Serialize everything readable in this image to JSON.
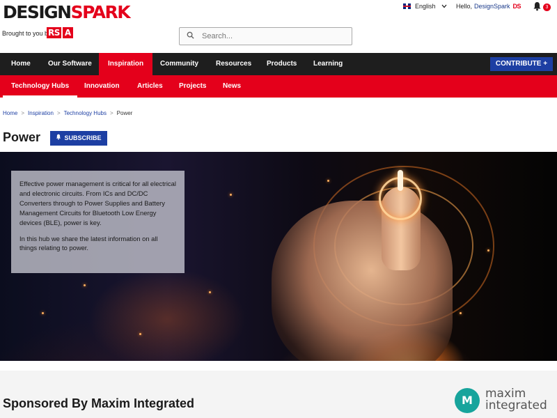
{
  "header": {
    "logo_part1": "DESIGN",
    "logo_part2": "SPARK",
    "brought_by": "Brought to you by",
    "partner_logo_1": "RS",
    "partner_logo_2": "A",
    "search_placeholder": "Search...",
    "language": "English",
    "greeting": "Hello,",
    "username": "DesignSpark",
    "user_badge": "DS",
    "notification_count": "3"
  },
  "main_nav": {
    "items": [
      "Home",
      "Our Software",
      "Inspiration",
      "Community",
      "Resources",
      "Products",
      "Learning"
    ],
    "active": "Inspiration",
    "contribute_label": "CONTRIBUTE +"
  },
  "sub_nav": {
    "items": [
      "Technology Hubs",
      "Innovation",
      "Articles",
      "Projects",
      "News"
    ],
    "active": "Technology Hubs"
  },
  "breadcrumb": [
    "Home",
    "Inspiration",
    "Technology Hubs",
    "Power"
  ],
  "page": {
    "title": "Power",
    "subscribe_label": "SUBSCRIBE"
  },
  "hero": {
    "paragraph1": "Effective power management is critical for all electrical and electronic circuits. From ICs and DC/DC Converters through to Power Supplies and Battery Management Circuits for Bluetooth Low Energy devices (BLE), power is key.",
    "paragraph2": "In this hub we share the latest information on all things relating to power."
  },
  "sponsor": {
    "title": "Sponsored By Maxim Integrated",
    "logo_text_1": "maxim",
    "logo_text_2": "integrated",
    "logo_mark": "M"
  },
  "colors": {
    "brand_red": "#e4001b",
    "nav_dark": "#1e1e1e",
    "accent_blue": "#1d3fa3",
    "maxim_teal": "#17a49c"
  }
}
